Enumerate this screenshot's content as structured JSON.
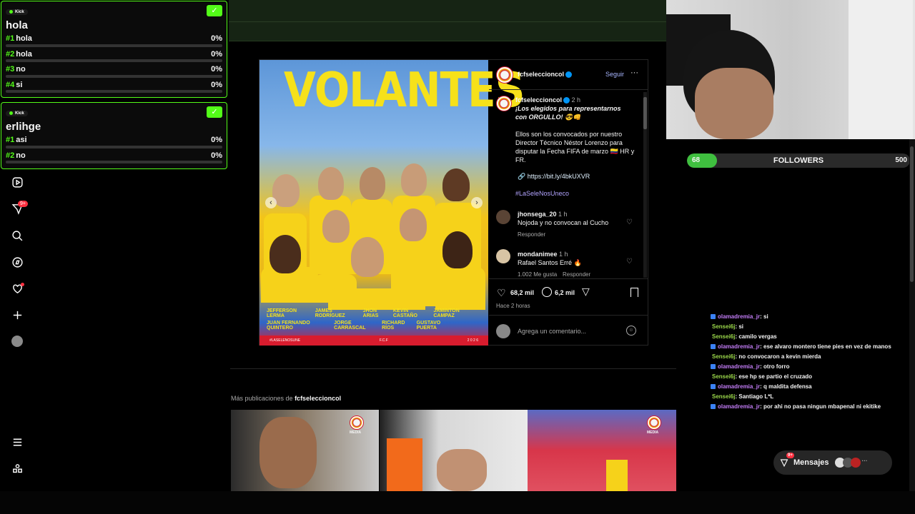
{
  "poll1": {
    "badge": "Kick",
    "title": "hola",
    "options": [
      {
        "num": "#1",
        "label": "hola",
        "pct": "0%"
      },
      {
        "num": "#2",
        "label": "hola",
        "pct": "0%"
      },
      {
        "num": "#3",
        "label": "no",
        "pct": "0%"
      },
      {
        "num": "#4",
        "label": "si",
        "pct": "0%"
      }
    ]
  },
  "poll2": {
    "badge": "Kick",
    "title": "erlihge",
    "options": [
      {
        "num": "#1",
        "label": "asi",
        "pct": "0%"
      },
      {
        "num": "#2",
        "label": "no",
        "pct": "0%"
      }
    ]
  },
  "nav": {
    "notifications_badge": "9+",
    "icons": [
      "reels-icon",
      "messages-icon",
      "search-icon",
      "explore-icon",
      "heart-icon",
      "create-icon",
      "profile-avatar",
      "menu-icon",
      "threads-icon"
    ]
  },
  "post": {
    "image": {
      "headline": "VOLANTES",
      "names_row1": [
        "JEFFERSON LERMA",
        "JAMES RODRÍGUEZ",
        "JHON ARIAS",
        "KEVIN CASTAÑO",
        "JAMINTON CAMPAZ"
      ],
      "names_row2": [
        "JUAN FERNANDO QUINTERO",
        "JORGE CARRASCAL",
        "RICHARD RÍOS",
        "GUSTAVO PUERTA"
      ],
      "footer_left": "#LASELENOSUNE",
      "footer_mid": "F.C.F",
      "footer_right": "2 0 2 6"
    },
    "header": {
      "username": "fcfseleccioncol",
      "follow": "Seguir",
      "more": "···"
    },
    "caption": {
      "username": "fcfseleccioncol",
      "time": "2 h",
      "line1": "¡Los elegidos para representarnos",
      "line2": "con ORGULLO! 😎👊",
      "body1": "Ellos son los convocados por nuestro",
      "body2": "Director Técnico Néstor Lorenzo para",
      "body3": "disputar la Fecha FIFA de marzo 🇨🇴 HR y",
      "body4": "FR.",
      "link": "https://bit.ly/4bkUXVR",
      "hashtag": "#LaSeleNosUneco"
    },
    "comments": [
      {
        "user": "jhonsega_20",
        "time": "1 h",
        "text": "Nojoda y no convocan al Cucho",
        "reply": "Responder",
        "likes": ""
      },
      {
        "user": "mondanimee",
        "time": "1 h",
        "text": "Rafael Santos Erré 🔥",
        "reply": "Responder",
        "likes": "1.002 Me gusta"
      }
    ],
    "likes": "68,2 mil",
    "comments_count": "6,2 mil",
    "timestamp": "Hace 2 horas",
    "comment_placeholder": "Agrega un comentario..."
  },
  "more": {
    "prefix": "Más publicaciones de ",
    "user": "fcfseleccioncol",
    "badge": "MEDIA"
  },
  "followers": {
    "current": "68",
    "label": "FOLLOWERS",
    "goal": "500",
    "progress": 0.136
  },
  "chat": [
    {
      "user": "olamadremia_jr",
      "type": "u1",
      "text": ": si"
    },
    {
      "user": "Sensei6j",
      "type": "u2",
      "text": ": si"
    },
    {
      "user": "Sensei6j",
      "type": "u2",
      "text": ": camilo vergas"
    },
    {
      "user": "olamadremia_jr",
      "type": "u1",
      "text": ": ese alvaro montero tiene pies en vez de manos"
    },
    {
      "user": "Sensei6j",
      "type": "u2",
      "text": ": no convocaron a kevin mierda"
    },
    {
      "user": "olamadremia_jr",
      "type": "u1",
      "text": ": otro forro"
    },
    {
      "user": "Sensei6j",
      "type": "u2",
      "text": ": ese hp se partio el cruzado"
    },
    {
      "user": "olamadremia_jr",
      "type": "u1",
      "text": ": q maldita defensa"
    },
    {
      "user": "Sensei6j",
      "type": "u2",
      "text": ": Santiago L*L"
    },
    {
      "user": "olamadremia_jr",
      "type": "u1",
      "text": ": por ahi no pasa ningun mbapenal ni ekitike"
    }
  ],
  "messages": {
    "label": "Mensajes",
    "badge": "9+"
  },
  "colors": {
    "kick_green": "#53fc18",
    "bg": "#000000",
    "link_blue": "#e0f1ff",
    "hashtag": "#b3a4ff"
  }
}
